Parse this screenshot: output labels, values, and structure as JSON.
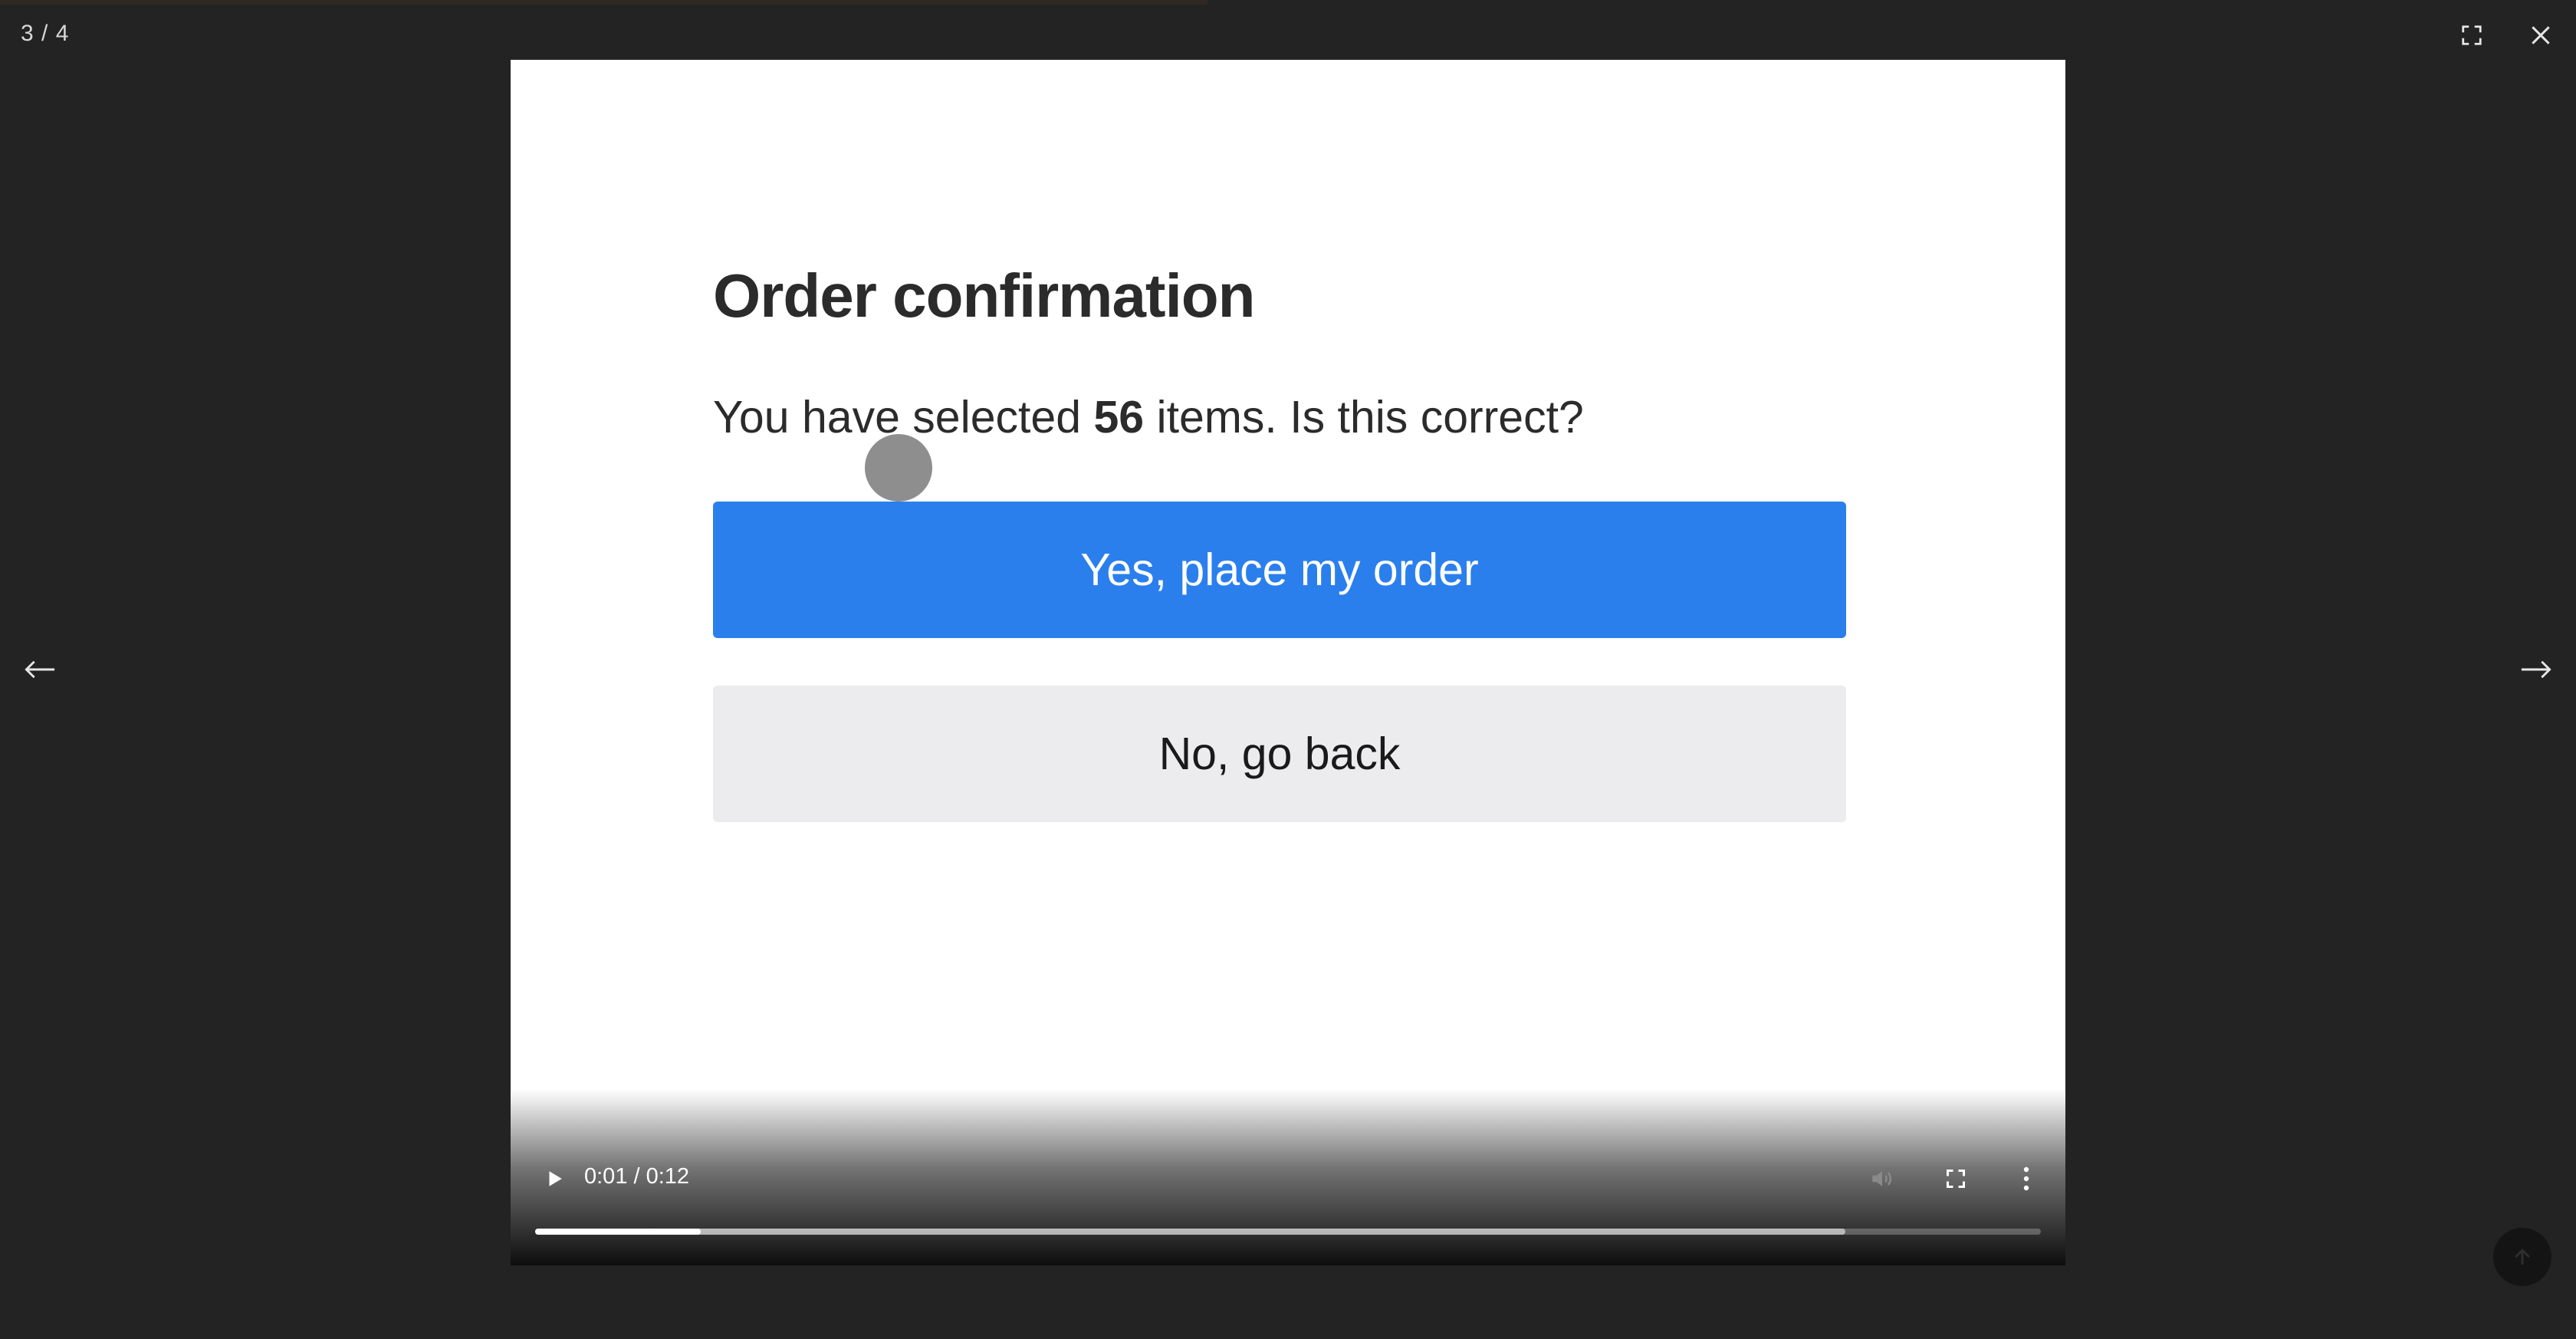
{
  "viewer": {
    "counter": "3 / 4",
    "icons": {
      "fullscreen": "fullscreen-icon",
      "close": "close-icon",
      "prev": "arrow-left-icon",
      "next": "arrow-right-icon",
      "scroll_top": "arrow-up-icon"
    }
  },
  "video": {
    "title": "Order confirmation",
    "question_prefix": "You have selected ",
    "question_count": "56",
    "question_suffix": " items. Is this correct?",
    "confirm_label": "Yes, place my order",
    "cancel_label": "No, go back",
    "colors": {
      "confirm_bg": "#2b7fed",
      "cancel_bg": "#ececee"
    }
  },
  "player": {
    "time": "0:01 / 0:12",
    "played_fraction": 0.11,
    "buffered_fraction": 0.87,
    "icons": {
      "play": "play-icon",
      "mute": "volume-icon",
      "fullscreen": "fullscreen-icon",
      "more": "more-vertical-icon"
    }
  }
}
